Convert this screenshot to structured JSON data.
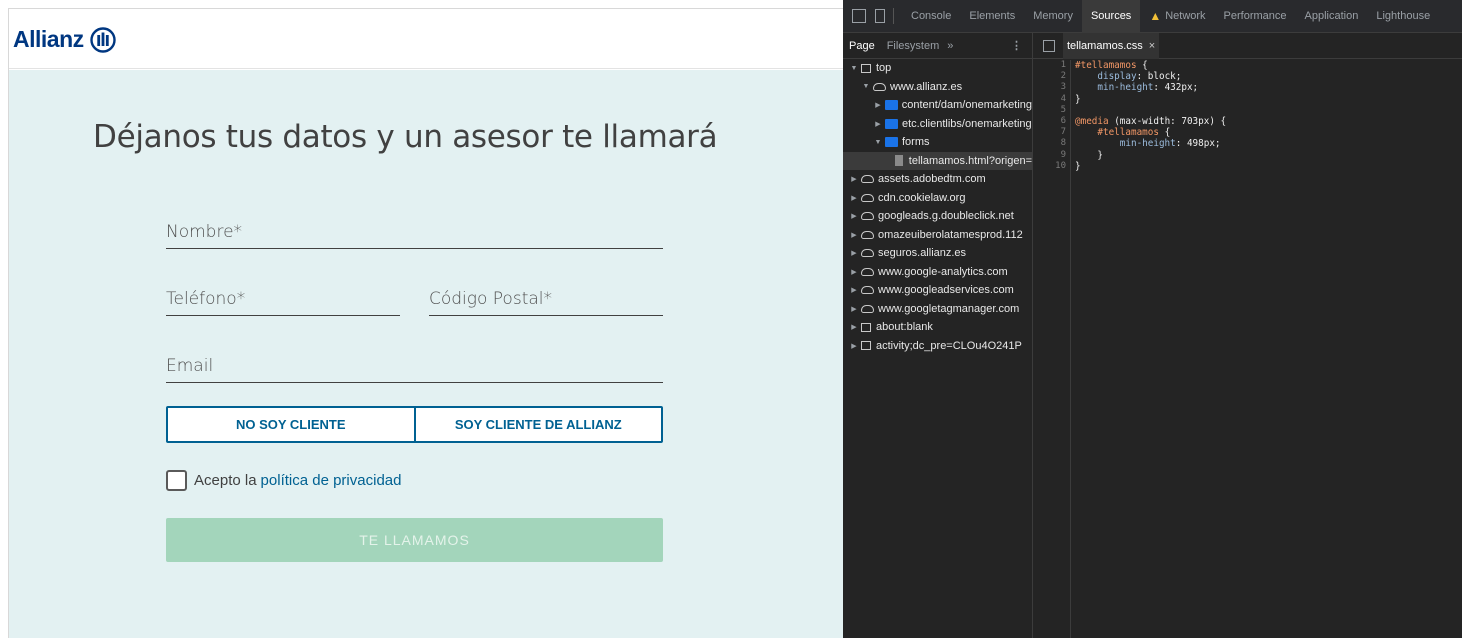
{
  "page": {
    "brand": "Allianz",
    "title": "Déjanos tus datos y un asesor te llamará",
    "fields": {
      "nombre": "Nombre*",
      "telefono": "Teléfono*",
      "codigo_postal": "Código Postal*",
      "email": "Email"
    },
    "toggle": {
      "option_a": "NO SOY CLIENTE",
      "option_b": "SOY CLIENTE DE ALLIANZ"
    },
    "privacy": {
      "prefix": "Acepto la",
      "link": "política de privacidad"
    },
    "submit": "TE LLAMAMOS",
    "colors": {
      "brand": "#003781",
      "accent": "#006192",
      "background": "#e3f1f2",
      "submit": "#a3d5bb"
    }
  },
  "devtools": {
    "tabs": [
      "Console",
      "Elements",
      "Memory",
      "Sources",
      "Network",
      "Performance",
      "Application",
      "Lighthouse"
    ],
    "active_tab": "Sources",
    "navigator": {
      "tabs": [
        "Page",
        "Filesystem"
      ],
      "more": "»",
      "tree": [
        {
          "label": "top",
          "icon": "frame",
          "indent": 0,
          "expanded": true
        },
        {
          "label": "www.allianz.es",
          "icon": "cloud",
          "indent": 1,
          "expanded": true
        },
        {
          "label": "content/dam/onemarketing",
          "icon": "folder",
          "indent": 2,
          "expanded": false
        },
        {
          "label": "etc.clientlibs/onemarketing",
          "icon": "folder",
          "indent": 2,
          "expanded": false
        },
        {
          "label": "forms",
          "icon": "folder",
          "indent": 2,
          "expanded": true
        },
        {
          "label": "tellamamos.html?origen=",
          "icon": "file",
          "indent": 3,
          "selected": true
        },
        {
          "label": "assets.adobedtm.com",
          "icon": "cloud",
          "indent": 0,
          "expanded": false
        },
        {
          "label": "cdn.cookielaw.org",
          "icon": "cloud",
          "indent": 0,
          "expanded": false
        },
        {
          "label": "googleads.g.doubleclick.net",
          "icon": "cloud",
          "indent": 0,
          "expanded": false
        },
        {
          "label": "omazeuiberolatamesprod.112",
          "icon": "cloud",
          "indent": 0,
          "expanded": false
        },
        {
          "label": "seguros.allianz.es",
          "icon": "cloud",
          "indent": 0,
          "expanded": false
        },
        {
          "label": "www.google-analytics.com",
          "icon": "cloud",
          "indent": 0,
          "expanded": false
        },
        {
          "label": "www.googleadservices.com",
          "icon": "cloud",
          "indent": 0,
          "expanded": false
        },
        {
          "label": "www.googletagmanager.com",
          "icon": "cloud",
          "indent": 0,
          "expanded": false
        },
        {
          "label": "about:blank",
          "icon": "frame",
          "indent": 0,
          "expanded": false
        },
        {
          "label": "activity;dc_pre=CLOu4O241P",
          "icon": "frame",
          "indent": 0,
          "expanded": false
        }
      ]
    },
    "editor": {
      "file_tab": "tellamamos.css",
      "lines": [
        [
          {
            "t": "#tellamamos",
            "c": "sel"
          },
          {
            "t": " {",
            "c": "val"
          }
        ],
        [
          {
            "t": "    display",
            "c": "prop"
          },
          {
            "t": ": block;",
            "c": "val"
          }
        ],
        [
          {
            "t": "    min-height",
            "c": "prop"
          },
          {
            "t": ": 432px;",
            "c": "val"
          }
        ],
        [
          {
            "t": "}",
            "c": "val"
          }
        ],
        [],
        [
          {
            "t": "@media",
            "c": "atr"
          },
          {
            "t": " (max-width: 703px) {",
            "c": "val"
          }
        ],
        [
          {
            "t": "    #tellamamos",
            "c": "sel"
          },
          {
            "t": " {",
            "c": "val"
          }
        ],
        [
          {
            "t": "        min-height",
            "c": "prop"
          },
          {
            "t": ": 498px;",
            "c": "val"
          }
        ],
        [
          {
            "t": "    }",
            "c": "val"
          }
        ],
        [
          {
            "t": "}",
            "c": "val"
          }
        ]
      ]
    }
  }
}
